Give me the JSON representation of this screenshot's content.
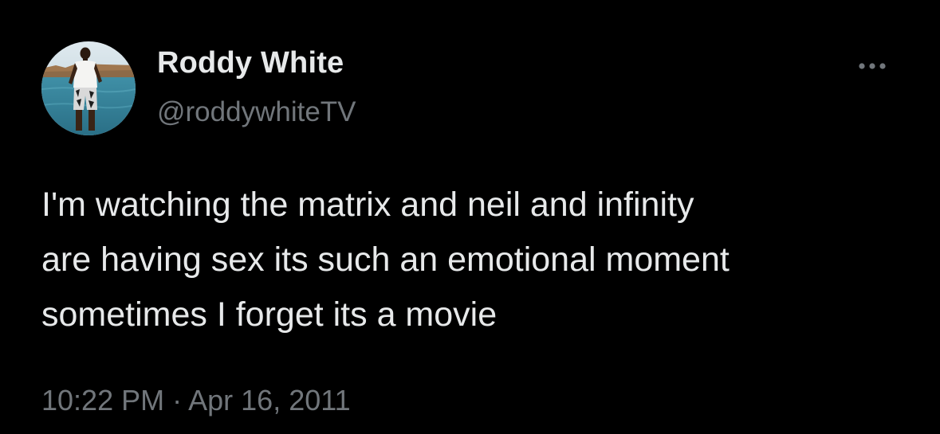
{
  "author": {
    "display_name": "Roddy White",
    "handle": "@roddywhiteTV",
    "avatar_icon": "profile-photo"
  },
  "menu": {
    "icon": "more-horizontal-icon",
    "glyph": "···"
  },
  "tweet": {
    "lines": [
      "I'm watching the matrix and neil and infinity",
      "are having sex its such an emotional moment",
      "sometimes I forget its a movie"
    ]
  },
  "meta": {
    "time": "10:22 PM",
    "separator": "·",
    "date": "Apr 16, 2011"
  },
  "colors": {
    "background": "#000000",
    "primary_text": "#e7e9ea",
    "secondary_text": "#71767b"
  }
}
